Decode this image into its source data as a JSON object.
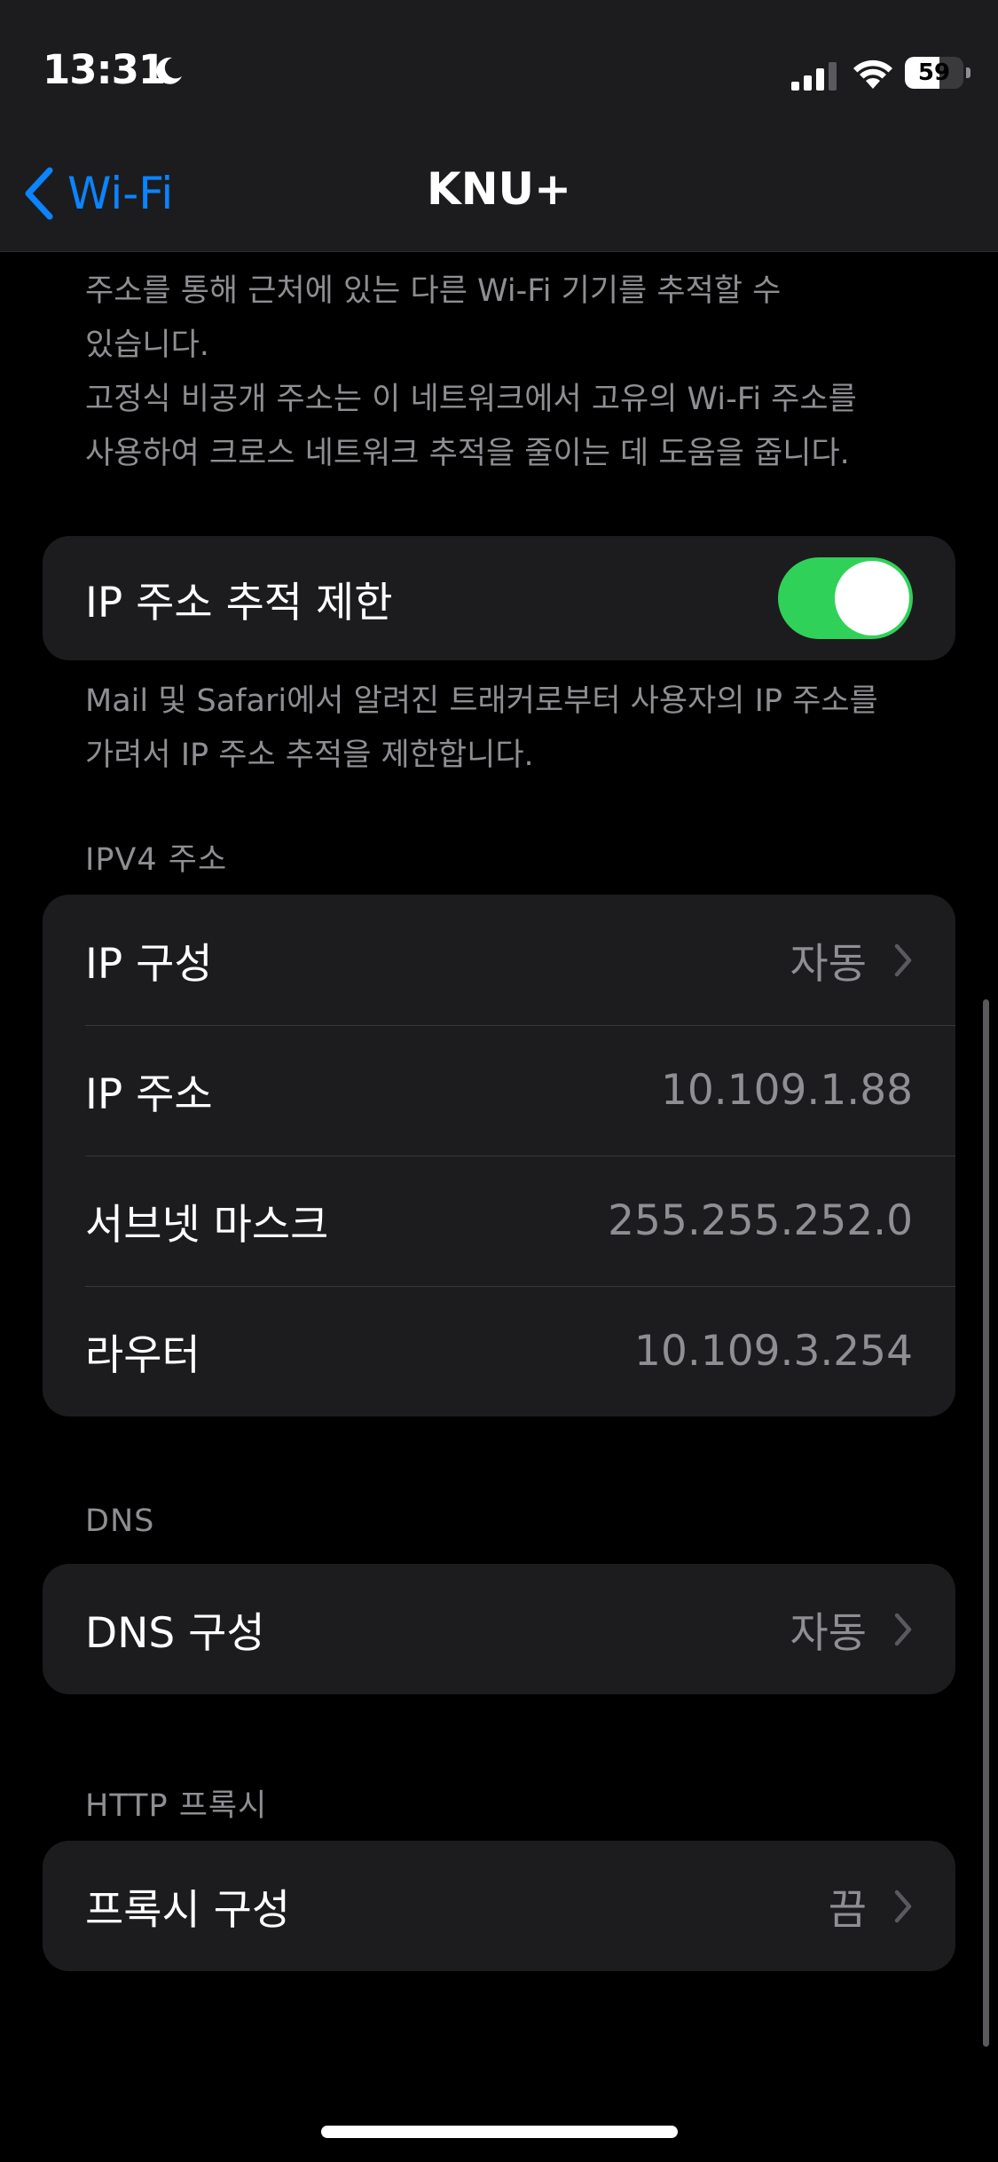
{
  "status_bar": {
    "time": "13:31",
    "battery_level": "59",
    "battery_fraction": 0.59,
    "icons": [
      "moon-icon",
      "signal-icon",
      "wifi-icon",
      "battery-icon"
    ]
  },
  "nav": {
    "back_label": "Wi-Fi",
    "title": "KNU+"
  },
  "private_address_footer": {
    "line1": "주소를 통해 근처에 있는 다른 Wi-Fi 기기를 추적할 수",
    "line2": "있습니다.",
    "line3": "고정식 비공개 주소는 이 네트워크에서 고유의 Wi-Fi 주소를",
    "line4": "사용하여 크로스 네트워크 추적을 줄이는 데 도움을 줍니다."
  },
  "limit_ip_tracking": {
    "label": "IP 주소 추적 제한",
    "enabled": true,
    "toggle_color": "#30d158",
    "footer_line1": "Mail 및 Safari에서 알려진 트래커로부터 사용자의 IP 주소를",
    "footer_line2": "가려서 IP 주소 추적을 제한합니다."
  },
  "ipv4": {
    "header": "IPV4 주소",
    "rows": [
      {
        "label": "IP 구성",
        "value": "자동"
      },
      {
        "label": "IP 주소",
        "value": "10.109.1.88"
      },
      {
        "label": "서브넷 마스크",
        "value": "255.255.252.0"
      },
      {
        "label": "라우터",
        "value": "10.109.3.254"
      }
    ]
  },
  "dns": {
    "header": "DNS",
    "row": {
      "label": "DNS 구성",
      "value": "자동"
    }
  },
  "http_proxy": {
    "header": "HTTP 프록시",
    "row": {
      "label": "프록시 구성",
      "value": "끔"
    }
  },
  "colors": {
    "accent": "#0a84ff",
    "background": "#000000",
    "cell_background": "#1c1c1e",
    "secondary_text": "#8e8e93"
  }
}
